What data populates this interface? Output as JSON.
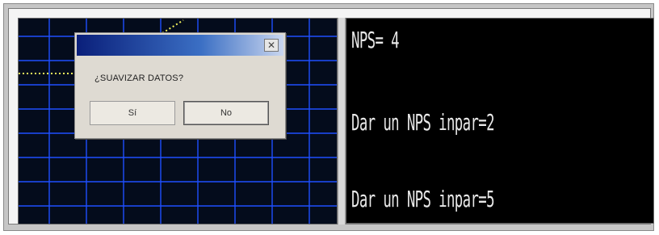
{
  "dialog": {
    "title": "",
    "message": "¿SUAVIZAR DATOS?",
    "yes_label": "Sí",
    "no_label": "No",
    "close_icon": "close-icon"
  },
  "console": {
    "lines": [
      "NPS= 4",
      "Dar un NPS inpar=2",
      "Dar un NPS inpar=5"
    ]
  },
  "colors": {
    "plot_background": "#040c1c",
    "grid": "#1f4fff",
    "trace": "#f2f25a",
    "console_text": "#e8e8e8"
  }
}
